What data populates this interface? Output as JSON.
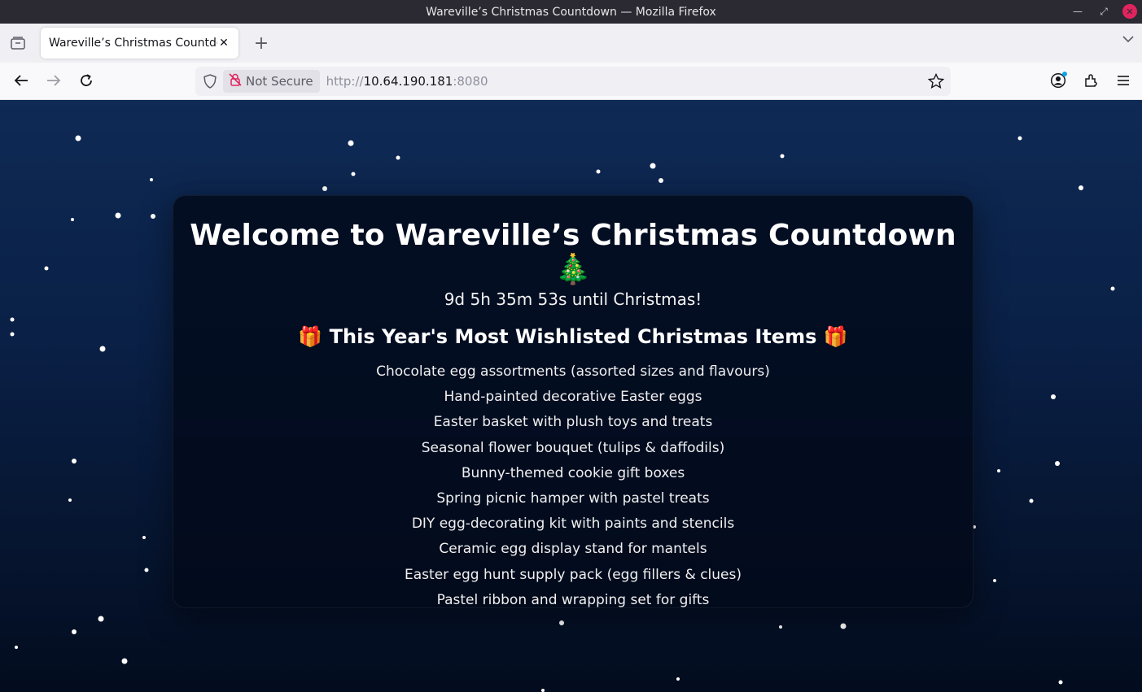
{
  "window": {
    "title": "Wareville’s Christmas Countdown — Mozilla Firefox"
  },
  "tabs": [
    {
      "title": "Wareville’s Christmas Countdown",
      "active": true
    }
  ],
  "navbar": {
    "not_secure_label": "Not Secure",
    "url_scheme": "http://",
    "url_host": "10.64.190.181",
    "url_port": ":8080"
  },
  "page": {
    "heading": "Welcome to Wareville’s Christmas Countdown 🎄",
    "countdown": "9d 5h 35m 53s until Christmas!",
    "wishlist_title": "🎁 This Year's Most Wishlisted Christmas Items 🎁",
    "wishlist": [
      "Chocolate egg assortments (assorted sizes and flavours)",
      "Hand-painted decorative Easter eggs",
      "Easter basket with plush toys and treats",
      "Seasonal flower bouquet (tulips & daffodils)",
      "Bunny-themed cookie gift boxes",
      "Spring picnic hamper with pastel treats",
      "DIY egg-decorating kit with paints and stencils",
      "Ceramic egg display stand for mantels",
      "Easter egg hunt supply pack (egg fillers & clues)",
      "Pastel ribbon and wrapping set for gifts"
    ]
  },
  "icons": {
    "back": "back-arrow-icon",
    "forward": "forward-arrow-icon",
    "reload": "reload-icon",
    "shield": "tracking-shield-icon",
    "not_secure": "not-secure-lock-icon",
    "bookmark": "star-icon",
    "account": "account-icon",
    "extensions": "extensions-icon",
    "menu": "hamburger-menu-icon"
  },
  "colors": {
    "page_bg_top": "#0e2a55",
    "page_bg_bottom": "#030c1e",
    "card_bg": "#030a1a",
    "text": "#ffffff"
  }
}
